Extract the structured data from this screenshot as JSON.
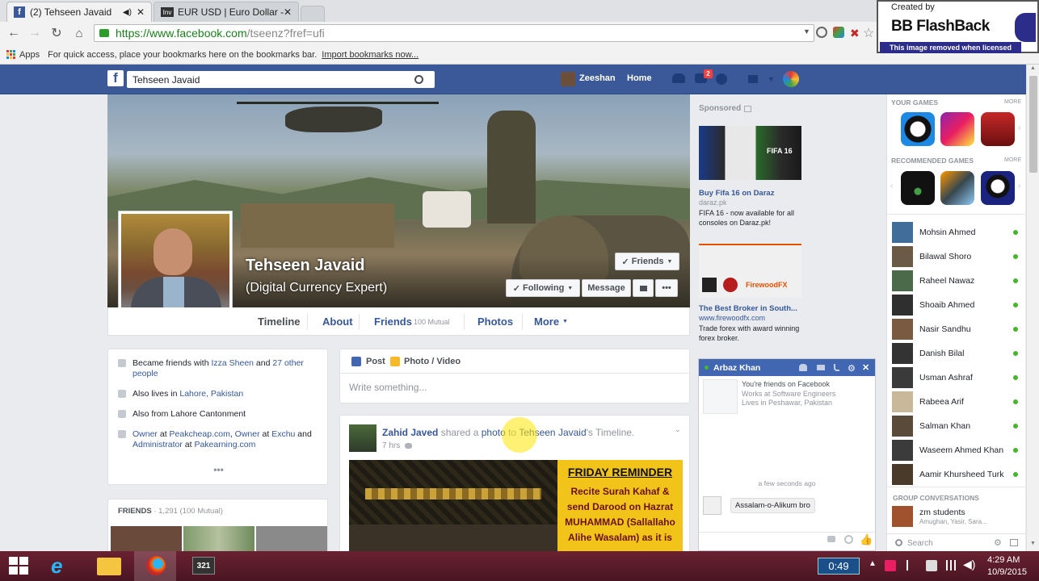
{
  "browser": {
    "tabs": [
      {
        "label": "(2) Tehseen Javaid"
      },
      {
        "label": "EUR USD | Euro Dollar - In"
      }
    ],
    "url_host": "https://www.facebook.com",
    "url_path": "/tseenz?fref=ufi",
    "bookmarks_apps": "Apps",
    "bookmarks_hint": "For quick access, place your bookmarks here on the bookmarks bar.",
    "bookmarks_import": "Import bookmarks now..."
  },
  "watermark": {
    "created_by": "Created by",
    "brand": "BB FlashBack",
    "note": "This image removed when licensed"
  },
  "fb": {
    "search_value": "Tehseen Javaid",
    "user_name": "Zeeshan",
    "home": "Home",
    "notif_count": "2",
    "profile": {
      "name": "Tehseen Javaid",
      "subtitle": "(Digital Currency Expert)",
      "friends_btn": "Friends",
      "following_btn": "Following",
      "message_btn": "Message",
      "more_btn": "•••"
    },
    "nav": {
      "timeline": "Timeline",
      "about": "About",
      "friends": "Friends",
      "friends_mutual": "100 Mutual",
      "photos": "Photos",
      "more": "More"
    },
    "intro": [
      {
        "pre": "Became friends with ",
        "link1": "Izza Sheen",
        "mid": " and ",
        "link2": "27 other people"
      },
      {
        "pre": "Also lives in ",
        "link1": "Lahore, Pakistan"
      },
      {
        "pre": "Also from Lahore Cantonment"
      },
      {
        "link1": "Owner",
        "pre": " at ",
        "link2": "Peakcheap.com",
        "sep": ", ",
        "link3": "Owner",
        "mid": " at ",
        "link4": "Exchu",
        "and": " and ",
        "link5": "Administrator",
        "at2": " at ",
        "link6": "Pakearning.com"
      }
    ],
    "intro_more": "•••",
    "friends_box": {
      "title": "FRIENDS",
      "count": " · 1,291 (100 Mutual)"
    },
    "composer": {
      "post": "Post",
      "photo": "Photo / Video",
      "placeholder": "Write something..."
    },
    "feed": {
      "author": "Zahid Javed",
      "shared": " shared a ",
      "photo": "photo",
      "to": " to ",
      "target": "Tehseen Javaid",
      "suffix": "'s Timeline.",
      "time": "7 hrs",
      "reminder_title": "FRIDAY REMINDER",
      "reminder_body": "Recite Surah Kahaf & send Darood on Hazrat MUHAMMAD (Sallallaho Alihe Wasalam) as it is"
    },
    "sponsored": {
      "label": "Sponsored",
      "ad1_title": "Buy Fifa 16 on Daraz",
      "ad1_url": "daraz.pk",
      "ad1_text": "FIFA 16 - now available for all consoles on Daraz.pk!",
      "ad1_img": "FIFA 16",
      "ad2_title": "The Best Broker in South...",
      "ad2_url": "www.firewoodfx.com",
      "ad2_text": "Trade forex with award winning forex broker.",
      "ad2_img": "FirewoodFX"
    },
    "chat": {
      "name": "Arbaz Khan",
      "line1": "You're friends on Facebook",
      "line2": "Works at Software Engineers",
      "line3": "Lives in Peshawar, Pakistan",
      "time": "a few seconds ago",
      "message": "Assalam-o-Alikum bro"
    },
    "games": {
      "your_games": "YOUR GAMES",
      "more": "MORE",
      "recommended": "RECOMMENDED GAMES",
      "more2": "MORE"
    },
    "contacts": [
      "Mohsin Ahmed",
      "Bilawal Shoro",
      "Raheel Nawaz",
      "Shoaib Ahmed",
      "Nasir Sandhu",
      "Danish Bilal",
      "Usman Ashraf",
      "Rabeea Arif",
      "Salman Khan",
      "Waseem Ahmed Khan",
      "Aamir Khursheed Turk"
    ],
    "group": {
      "title": "GROUP CONVERSATIONS",
      "name": "zm students",
      "members": "Amughan, Yasir, Sara..."
    },
    "chat_search": "Search"
  },
  "taskbar": {
    "recording": "0:49",
    "time": "4:29 AM",
    "date": "10/9/2015"
  },
  "colors": {
    "fb_blue": "#3b5998",
    "link": "#365899",
    "online": "#42b72a",
    "taskbar": "#5a1a2a"
  }
}
